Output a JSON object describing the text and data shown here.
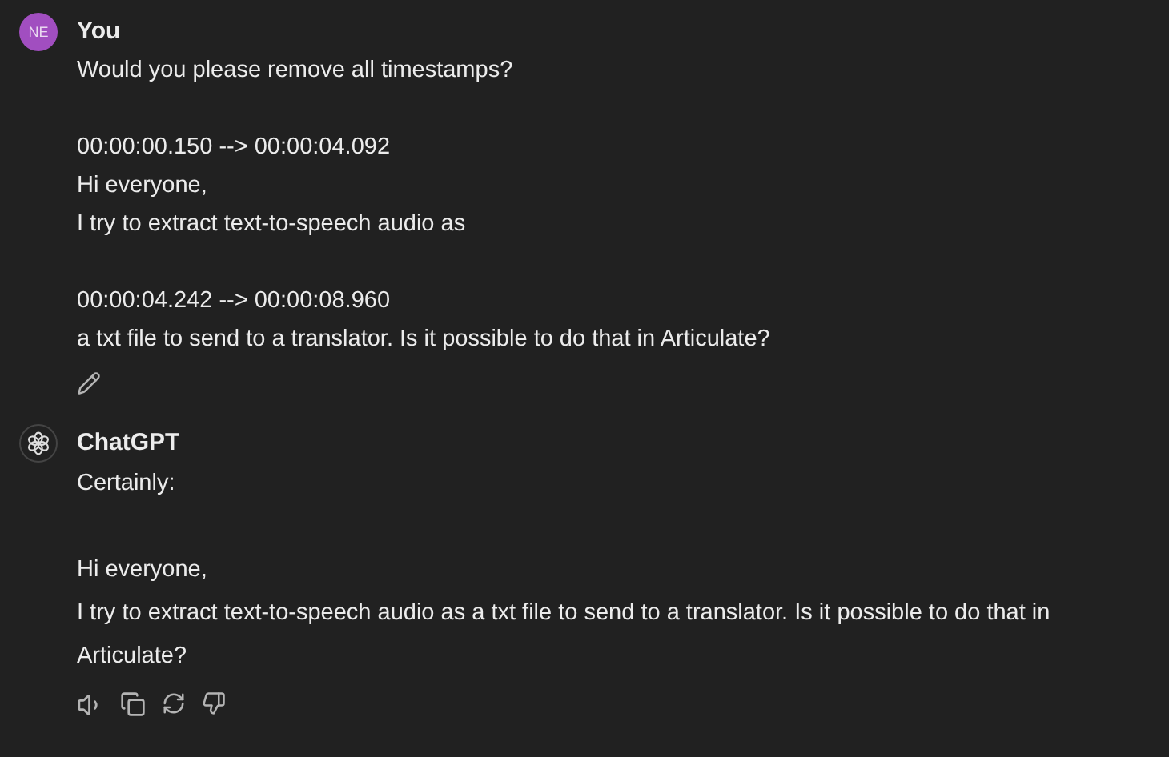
{
  "messages": [
    {
      "kind": "user",
      "avatar": "NE",
      "author": "You",
      "paragraphs": [
        [
          "Would you please remove all timestamps?"
        ],
        [
          "00:00:00.150 --> 00:00:04.092",
          "Hi everyone,",
          "I try to extract text-to-speech audio as"
        ],
        [
          "00:00:04.242 --> 00:00:08.960",
          "a txt file to send to a translator. Is it possible to do that in Articulate?"
        ]
      ]
    },
    {
      "kind": "assistant",
      "author": "ChatGPT",
      "paragraphs": [
        [
          "Certainly:"
        ],
        [
          "Hi everyone,",
          "I try to extract text-to-speech audio as a txt file to send to a translator. Is it possible to do that in Articulate?"
        ]
      ]
    }
  ]
}
